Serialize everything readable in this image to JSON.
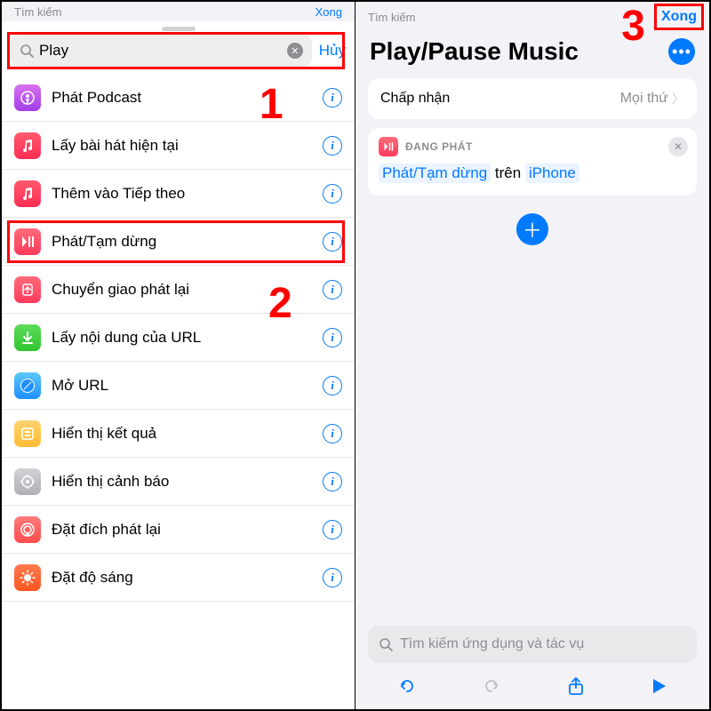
{
  "left": {
    "peek_back": "Tìm kiếm",
    "peek_done": "Xong",
    "search_value": "Play",
    "cancel_label": "Hủy",
    "items": [
      {
        "label": "Phát Podcast",
        "icon": "podcast"
      },
      {
        "label": "Lấy bài hát hiện tại",
        "icon": "music"
      },
      {
        "label": "Thêm vào Tiếp theo",
        "icon": "music"
      },
      {
        "label": "Phát/Tạm dừng",
        "icon": "playpause"
      },
      {
        "label": "Chuyển giao phát lại",
        "icon": "handoff"
      },
      {
        "label": "Lấy nội dung của URL",
        "icon": "url"
      },
      {
        "label": "Mở URL",
        "icon": "safari"
      },
      {
        "label": "Hiển thị kết quả",
        "icon": "results"
      },
      {
        "label": "Hiển thị cảnh báo",
        "icon": "alert"
      },
      {
        "label": "Đặt đích phát lại",
        "icon": "dest"
      },
      {
        "label": "Đặt độ sáng",
        "icon": "bright"
      }
    ]
  },
  "right": {
    "peek_back": "Tìm kiếm",
    "done": "Xong",
    "title": "Play/Pause Music",
    "accept_label": "Chấp nhận",
    "accept_value": "Mọi thứ",
    "action_header": "ĐANG PHÁT",
    "action_param1": "Phát/Tạm dừng",
    "action_mid": "trên",
    "action_param2": "iPhone",
    "search_placeholder": "Tìm kiếm ứng dụng và tác vụ"
  },
  "annotations": {
    "n1": "1",
    "n2": "2",
    "n3": "3"
  }
}
